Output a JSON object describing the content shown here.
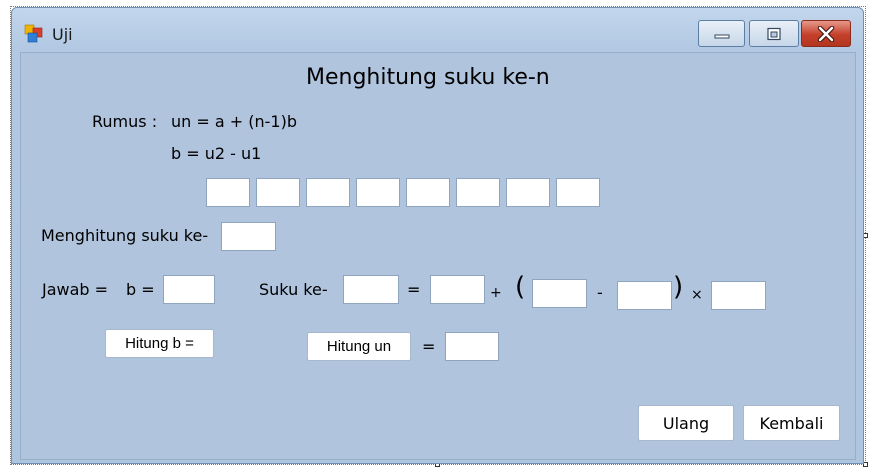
{
  "window": {
    "title": "Uji",
    "icon": "windows-forms-app-icon",
    "controls": {
      "minimize_icon": "minimize-icon",
      "maximize_icon": "maximize-icon",
      "close_icon": "close-icon",
      "close_color": "#c4402a"
    }
  },
  "form": {
    "heading": "Menghitung suku ke-n",
    "formula_label": "Rumus :",
    "formula_un": "un = a + (n-1)b",
    "formula_b": "b = u2 - u1",
    "sequence_inputs": [
      "",
      "",
      "",
      "",
      "",
      "",
      "",
      ""
    ],
    "n_label": "Menghitung suku ke-",
    "n_value": "",
    "answer_label": "Jawab =",
    "b_label": "b =",
    "b_value": "",
    "suku_label": "Suku ke-",
    "suku_value": "",
    "equals1": "=",
    "a_value": "",
    "plus": "+",
    "open_paren": "(",
    "n_term_value": "",
    "minus": "-",
    "one_value": "",
    "close_paren": ")",
    "times": "×",
    "b_term_value": "",
    "hitung_b_label": "Hitung b =",
    "hitung_un_label": "Hitung un",
    "equals2": "=",
    "un_result": "",
    "ulang_label": "Ulang",
    "kembali_label": "Kembali"
  },
  "colors": {
    "form_background": "#b0c4de",
    "titlebar_gradient_top": "#c2d6ec"
  }
}
